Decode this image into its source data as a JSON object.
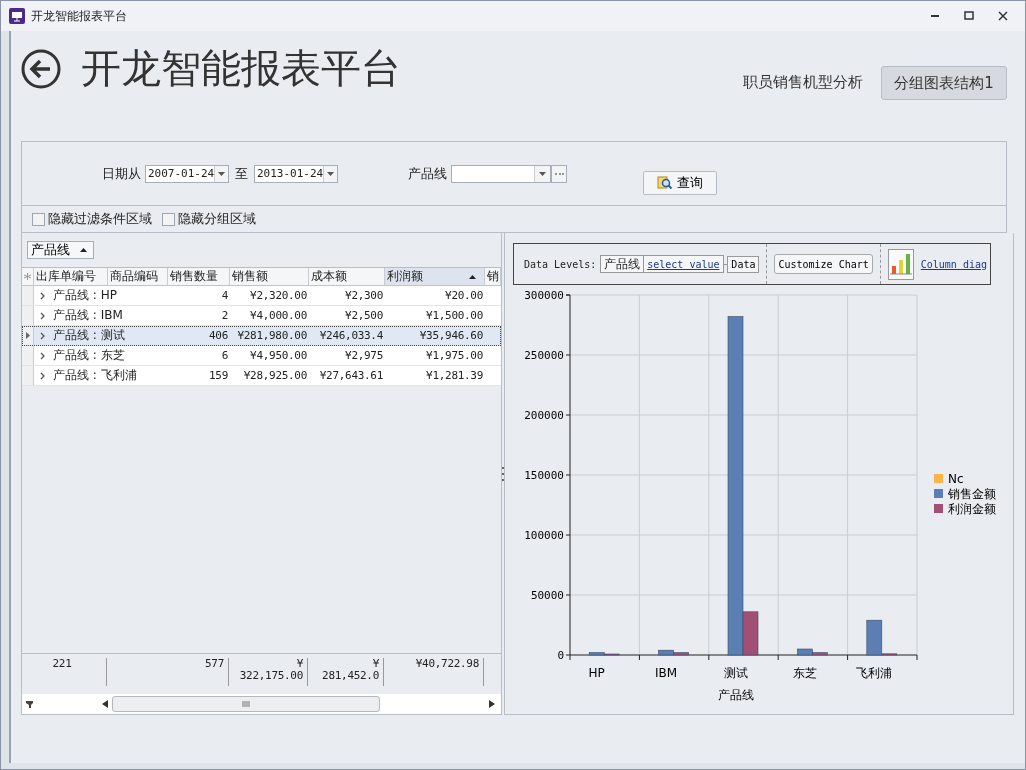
{
  "window": {
    "title": "开龙智能报表平台"
  },
  "header": {
    "title": "开龙智能报表平台",
    "subtitle": "职员销售机型分析",
    "button": "分组图表结构1"
  },
  "filter": {
    "date_from_label": "日期从",
    "date_from": "2007-01-24",
    "to_label": "至",
    "date_to": "2013-01-24",
    "product_line_label": "产品线",
    "query_button": "查询"
  },
  "options": [
    {
      "label": "隐藏过滤条件区域",
      "checked": false
    },
    {
      "label": "隐藏分组区域",
      "checked": false
    }
  ],
  "grid": {
    "group_by": "产品线",
    "columns": [
      {
        "label": "出库单编号",
        "sorted": false
      },
      {
        "label": "商品编码",
        "sorted": false
      },
      {
        "label": "销售数量",
        "sorted": false
      },
      {
        "label": "销售额",
        "sorted": false
      },
      {
        "label": "成本额",
        "sorted": false
      },
      {
        "label": "利润额",
        "sorted": true
      },
      {
        "label": "销",
        "sorted": false
      }
    ],
    "rows": [
      {
        "label": "产品线 : HP",
        "cells": [
          "4",
          "¥2,320.00",
          "¥2,300",
          "¥20.00"
        ],
        "selected": false
      },
      {
        "label": "产品线 : IBM",
        "cells": [
          "2",
          "¥4,000.00",
          "¥2,500",
          "¥1,500.00"
        ],
        "selected": false
      },
      {
        "label": "产品线 : 测试",
        "cells": [
          "406",
          "¥281,980.00",
          "¥246,033.4",
          "¥35,946.60"
        ],
        "selected": true
      },
      {
        "label": "产品线 : 东芝",
        "cells": [
          "6",
          "¥4,950.00",
          "¥2,975",
          "¥1,975.00"
        ],
        "selected": false
      },
      {
        "label": "产品线 : 飞利浦",
        "cells": [
          "159",
          "¥28,925.00",
          "¥27,643.61",
          "¥1,281.39"
        ],
        "selected": false
      }
    ],
    "footer": [
      "221",
      "577",
      "¥\n322,175.00",
      "¥\n281,452.0",
      "¥40,722.98"
    ]
  },
  "chart_panel": {
    "data_levels_label": "Data Levels:",
    "level": "产品线",
    "select_value": "select value",
    "data": "Data",
    "customize": "Customize Chart",
    "chart_type": "Column diag",
    "chart_data": {
      "type": "bar",
      "xlabel": "产品线",
      "categories": [
        "HP",
        "IBM",
        "测试",
        "东芝",
        "飞利浦"
      ],
      "series": [
        {
          "name": "Nc",
          "color": "#f9b54a",
          "values": [
            null,
            null,
            null,
            null,
            null
          ]
        },
        {
          "name": "销售金额",
          "color": "#5b7fb2",
          "values": [
            2000,
            4000,
            282000,
            5000,
            29000
          ]
        },
        {
          "name": "利润金额",
          "color": "#a14f75",
          "values": [
            0,
            2000,
            36000,
            2000,
            1000
          ]
        }
      ],
      "grid": true,
      "legend": true,
      "ylim": [
        0,
        300000
      ],
      "yticks": [
        0,
        50000,
        100000,
        150000,
        200000,
        250000,
        300000
      ]
    }
  }
}
